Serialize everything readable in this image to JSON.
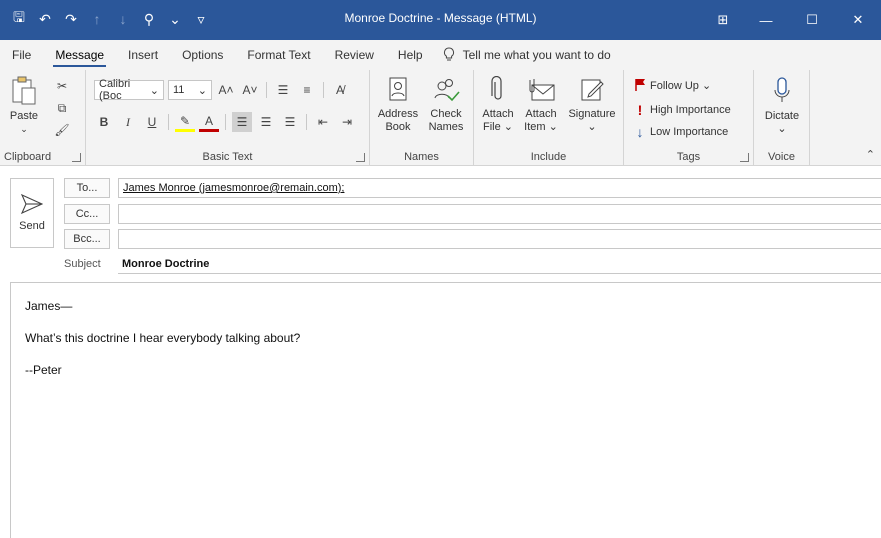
{
  "window": {
    "title": "Monroe Doctrine  -  Message (HTML)",
    "controls": {
      "minimize": "—",
      "maximize": "☐",
      "close": "✕",
      "ribbon_options": "⊞"
    }
  },
  "qat": {
    "save": "🖫",
    "undo": "↶",
    "redo": "↷",
    "up": "↑",
    "down": "↓",
    "attach": "⚲",
    "more": "⌄",
    "customize": "▿"
  },
  "menu": {
    "tabs": [
      "File",
      "Message",
      "Insert",
      "Options",
      "Format Text",
      "Review",
      "Help"
    ],
    "active": "Message",
    "tell_me": "Tell me what you want to do"
  },
  "ribbon": {
    "clipboard": {
      "paste": "Paste",
      "label": "Clipboard"
    },
    "basic_text": {
      "font": "Calibri (Boc",
      "size": "11",
      "label": "Basic Text",
      "bold": "B",
      "italic": "I",
      "underline": "U"
    },
    "names": {
      "address_book_1": "Address",
      "address_book_2": "Book",
      "check_names_1": "Check",
      "check_names_2": "Names",
      "label": "Names"
    },
    "include": {
      "attach_file_1": "Attach",
      "attach_file_2": "File ⌄",
      "attach_item_1": "Attach",
      "attach_item_2": "Item ⌄",
      "signature_1": "Signature",
      "signature_2": "⌄",
      "label": "Include"
    },
    "tags": {
      "follow_up": "Follow Up ⌄",
      "high_importance": "High Importance",
      "low_importance": "Low Importance",
      "label": "Tags"
    },
    "voice": {
      "dictate_1": "Dictate",
      "dictate_2": "⌄",
      "label": "Voice"
    },
    "collapse": "⌃"
  },
  "compose": {
    "send_label": "Send",
    "to_button": "To...",
    "cc_button": "Cc...",
    "bcc_button": "Bcc...",
    "to_value": "James Monroe (jamesmonroe@remain.com);",
    "cc_value": "",
    "bcc_value": "",
    "subject_label": "Subject",
    "subject_value": "Monroe Doctrine",
    "body": [
      "James—",
      "What’s this doctrine I hear everybody talking about?",
      "--Peter"
    ]
  },
  "colors": {
    "title_bar": "#2b579a",
    "ribbon_bg": "#f3f3f3",
    "flag": "#c00000",
    "high_importance": "#c00000",
    "low_importance": "#2b579a"
  }
}
